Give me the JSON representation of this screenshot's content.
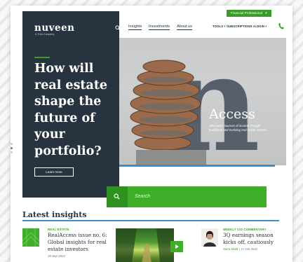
{
  "header": {
    "badge": "Financial Professional",
    "badge_caret": "▾",
    "nav": [
      "Insights",
      "Investments",
      "About us"
    ],
    "utils": [
      {
        "label": "TOOLS",
        "caret": "▾"
      },
      {
        "label": "SUBSCRIPTIONS",
        "caret": "▾"
      },
      {
        "label": "LOGIN",
        "caret": "▾"
      }
    ],
    "icons": {
      "search": "search-icon",
      "phone": "phone-icon"
    }
  },
  "brand": {
    "name": "nuveen",
    "tagline": "A TIAA Company"
  },
  "hero": {
    "headline": "How will real estate shape the future of your portfolio?",
    "cta": "Learn more",
    "overlay_title": "Access",
    "overlay_text": "alternative sources of income through traditional and evolving real estate sectors.",
    "search_placeholder": "Search",
    "slide_count": 3,
    "active_slide": 2
  },
  "latest": {
    "title": "Latest insights",
    "cards": [
      {
        "tag": "REAL ESTATE",
        "title": "RealAccess issue no. 6: Global insights for real estate investors",
        "date": "26 Sep 2022"
      },
      {
        "tag": "WEEKLY CIO COMMENTARY",
        "title": "3Q earnings season kicks off, cautiously",
        "author": "Saira Malik",
        "date": "17 Oct 2022"
      }
    ]
  },
  "colors": {
    "navy": "#27333e",
    "green": "#3fae29",
    "blue": "#3d8ec8"
  }
}
